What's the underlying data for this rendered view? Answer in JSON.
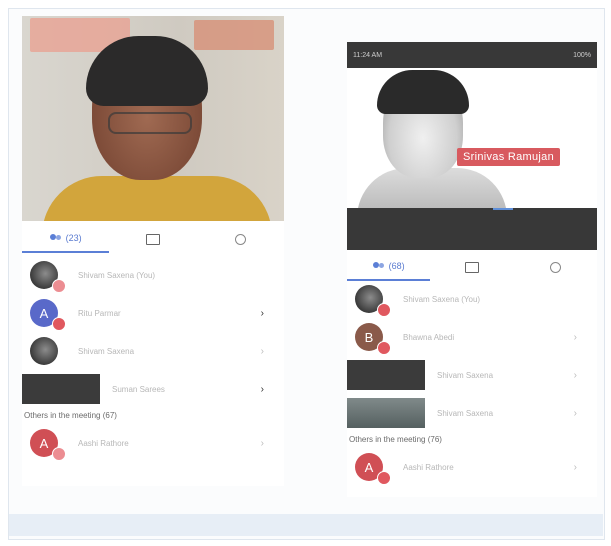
{
  "left": {
    "tabs": [
      {
        "label": "(23)",
        "icon": "people-icon"
      },
      {
        "label": "",
        "icon": "chat-icon"
      },
      {
        "label": "",
        "icon": "info-icon"
      }
    ],
    "participants": [
      {
        "name": "Shivam Saxena (You)",
        "avatar_letter": "",
        "avatar_style": "photo",
        "chevron": ""
      },
      {
        "name": "Ritu Parmar",
        "avatar_letter": "A",
        "avatar_style": "blue",
        "chevron": "›"
      },
      {
        "name": "Shivam Saxena",
        "avatar_letter": "",
        "avatar_style": "photo",
        "chevron": "›"
      },
      {
        "name": "Suman Sarees",
        "avatar_letter": "",
        "avatar_style": "wide",
        "chevron": "›"
      }
    ],
    "others_label": "Others in the meeting (67)",
    "others": [
      {
        "name": "Aashi Rathore",
        "avatar_letter": "A",
        "avatar_style": "red",
        "chevron": "›"
      }
    ]
  },
  "right": {
    "status_time": "11:24 AM",
    "status_right": "100%",
    "banner_name": "Srinivas Ramujan",
    "tabs": [
      {
        "label": "(68)",
        "icon": "people-icon"
      },
      {
        "label": "",
        "icon": "chat-icon"
      },
      {
        "label": "",
        "icon": "info-icon"
      }
    ],
    "participants": [
      {
        "name": "Shivam Saxena (You)",
        "avatar_letter": "",
        "avatar_style": "photo",
        "chevron": ""
      },
      {
        "name": "Bhawna Abedi",
        "avatar_letter": "B",
        "avatar_style": "brown",
        "chevron": "›"
      },
      {
        "name": "Shivam Saxena",
        "avatar_letter": "",
        "avatar_style": "wide",
        "chevron": "›"
      },
      {
        "name": "Shivam Saxena",
        "avatar_letter": "",
        "avatar_style": "wide-photo",
        "chevron": "›"
      }
    ],
    "others_label": "Others in the meeting (76)",
    "others": [
      {
        "name": "Aashi Rathore",
        "avatar_letter": "A",
        "avatar_style": "red",
        "chevron": "›"
      }
    ]
  },
  "colors": {
    "accent": "#5b7fd6",
    "badge": "#e0585f",
    "banner": "#d85a5f"
  }
}
